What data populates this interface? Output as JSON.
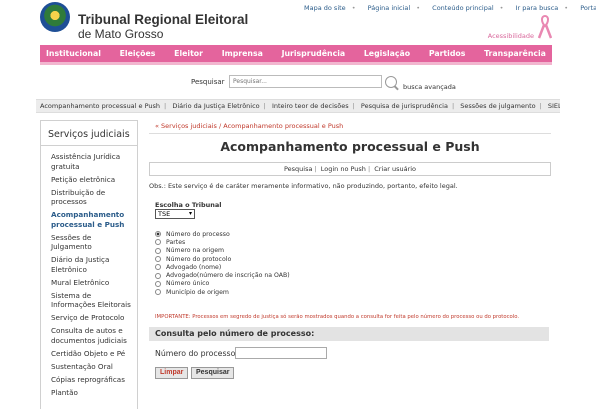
{
  "header": {
    "title": "Tribunal Regional Eleitoral",
    "subtitle": "de Mato Grosso",
    "top_links": [
      "Mapa do site",
      "Página inicial",
      "Conteúdo principal",
      "Ir para busca",
      "Portal JE"
    ],
    "accessibility": "Acessibilidade",
    "brand_pink": "#e4649d"
  },
  "nav": {
    "items": [
      "Institucional",
      "Eleições",
      "Eleitor",
      "Imprensa",
      "Jurisprudência",
      "Legislação",
      "Partidos",
      "Transparência"
    ]
  },
  "search": {
    "label": "Pesquisar",
    "placeholder": "Pesquisar...",
    "advanced": "busca avançada"
  },
  "subnav": {
    "items": [
      "Acompanhamento processual e Push",
      "Diário da Justiça Eletrônico",
      "Inteiro teor de decisões",
      "Pesquisa de jurisprudência",
      "Sessões de julgamento",
      "SIEL"
    ]
  },
  "sidebar": {
    "title": "Serviços judiciais",
    "items": [
      "Assistência Jurídica gratuita",
      "Petição eletrônica",
      "Distribuição de processos",
      "Acompanhamento processual e Push",
      "Sessões de Julgamento",
      "Diário da Justiça Eletrônico",
      "Mural Eletrônico",
      "Sistema de Informações Eleitorais",
      "Serviço de Protocolo",
      "Consulta de autos e documentos judiciais",
      "Certidão Objeto e Pé",
      "Sustentação Oral",
      "Cópias reprográficas",
      "Plantão"
    ]
  },
  "main": {
    "breadcrumb": "« Serviços judiciais / Acompanhamento processual e Push",
    "title": "Acompanhamento processual e Push",
    "tabs": [
      "Pesquisa",
      "Login no Push",
      "Criar usuário"
    ],
    "obs": "Obs.: Este serviço é de caráter meramente informativo, não produzindo, portanto, efeito legal.",
    "tribunal_label": "Escolha o Tribunal",
    "tribunal_value": "TSE",
    "options": [
      "Número do processo",
      "Partes",
      "Número na origem",
      "Número do protocolo",
      "Advogado (nome)",
      "Advogado(número de inscrição na OAB)",
      "Número único",
      "Município de origem"
    ],
    "important": "IMPORTANTE: Processos em segredo de justiça só serão mostrados quando a consulta for feita pelo número do processo ou do protocolo.",
    "consulta_heading": "Consulta pelo número de processo:",
    "process_label": "Número do processo:",
    "process_value": "",
    "clear_label": "Limpar",
    "search_label": "Pesquisar"
  }
}
